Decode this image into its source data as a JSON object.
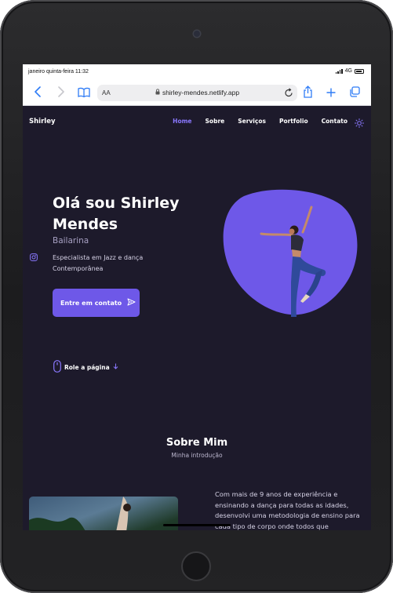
{
  "status_bar": {
    "time": "janeiro quinta-feira 11:32",
    "network": "4G"
  },
  "browser": {
    "aa_label": "AA",
    "url": "shirley-mendes.netlify.app"
  },
  "nav": {
    "brand": "Shirley",
    "links": [
      {
        "label": "Home",
        "active": true
      },
      {
        "label": "Sobre",
        "active": false
      },
      {
        "label": "Serviços",
        "active": false
      },
      {
        "label": "Portfolio",
        "active": false
      },
      {
        "label": "Contato",
        "active": false
      }
    ]
  },
  "hero": {
    "title": "Olá sou Shirley Mendes",
    "subtitle": "Bailarina",
    "description": "Especialista em Jazz e dança Contemporânea",
    "cta_label": "Entre em contato",
    "scroll_label": "Role a página"
  },
  "about": {
    "title": "Sobre Mim",
    "subtitle": "Minha introdução",
    "text": "Com mais de 9 anos de experiência e ensinando a dança para todas as idades, desenvolvi uma metodologia de ensino para cada tipo de corpo onde todos que"
  },
  "colors": {
    "accent": "#6e58e8",
    "background": "#1d1a2b",
    "active_link": "#8a78ff"
  },
  "icons": [
    "back-icon",
    "forward-icon",
    "bookmarks-icon",
    "lock-icon",
    "reload-icon",
    "share-icon",
    "new-tab-icon",
    "tabs-icon",
    "theme-sun-icon",
    "instagram-icon",
    "send-icon",
    "mouse-icon",
    "arrow-down-icon"
  ]
}
